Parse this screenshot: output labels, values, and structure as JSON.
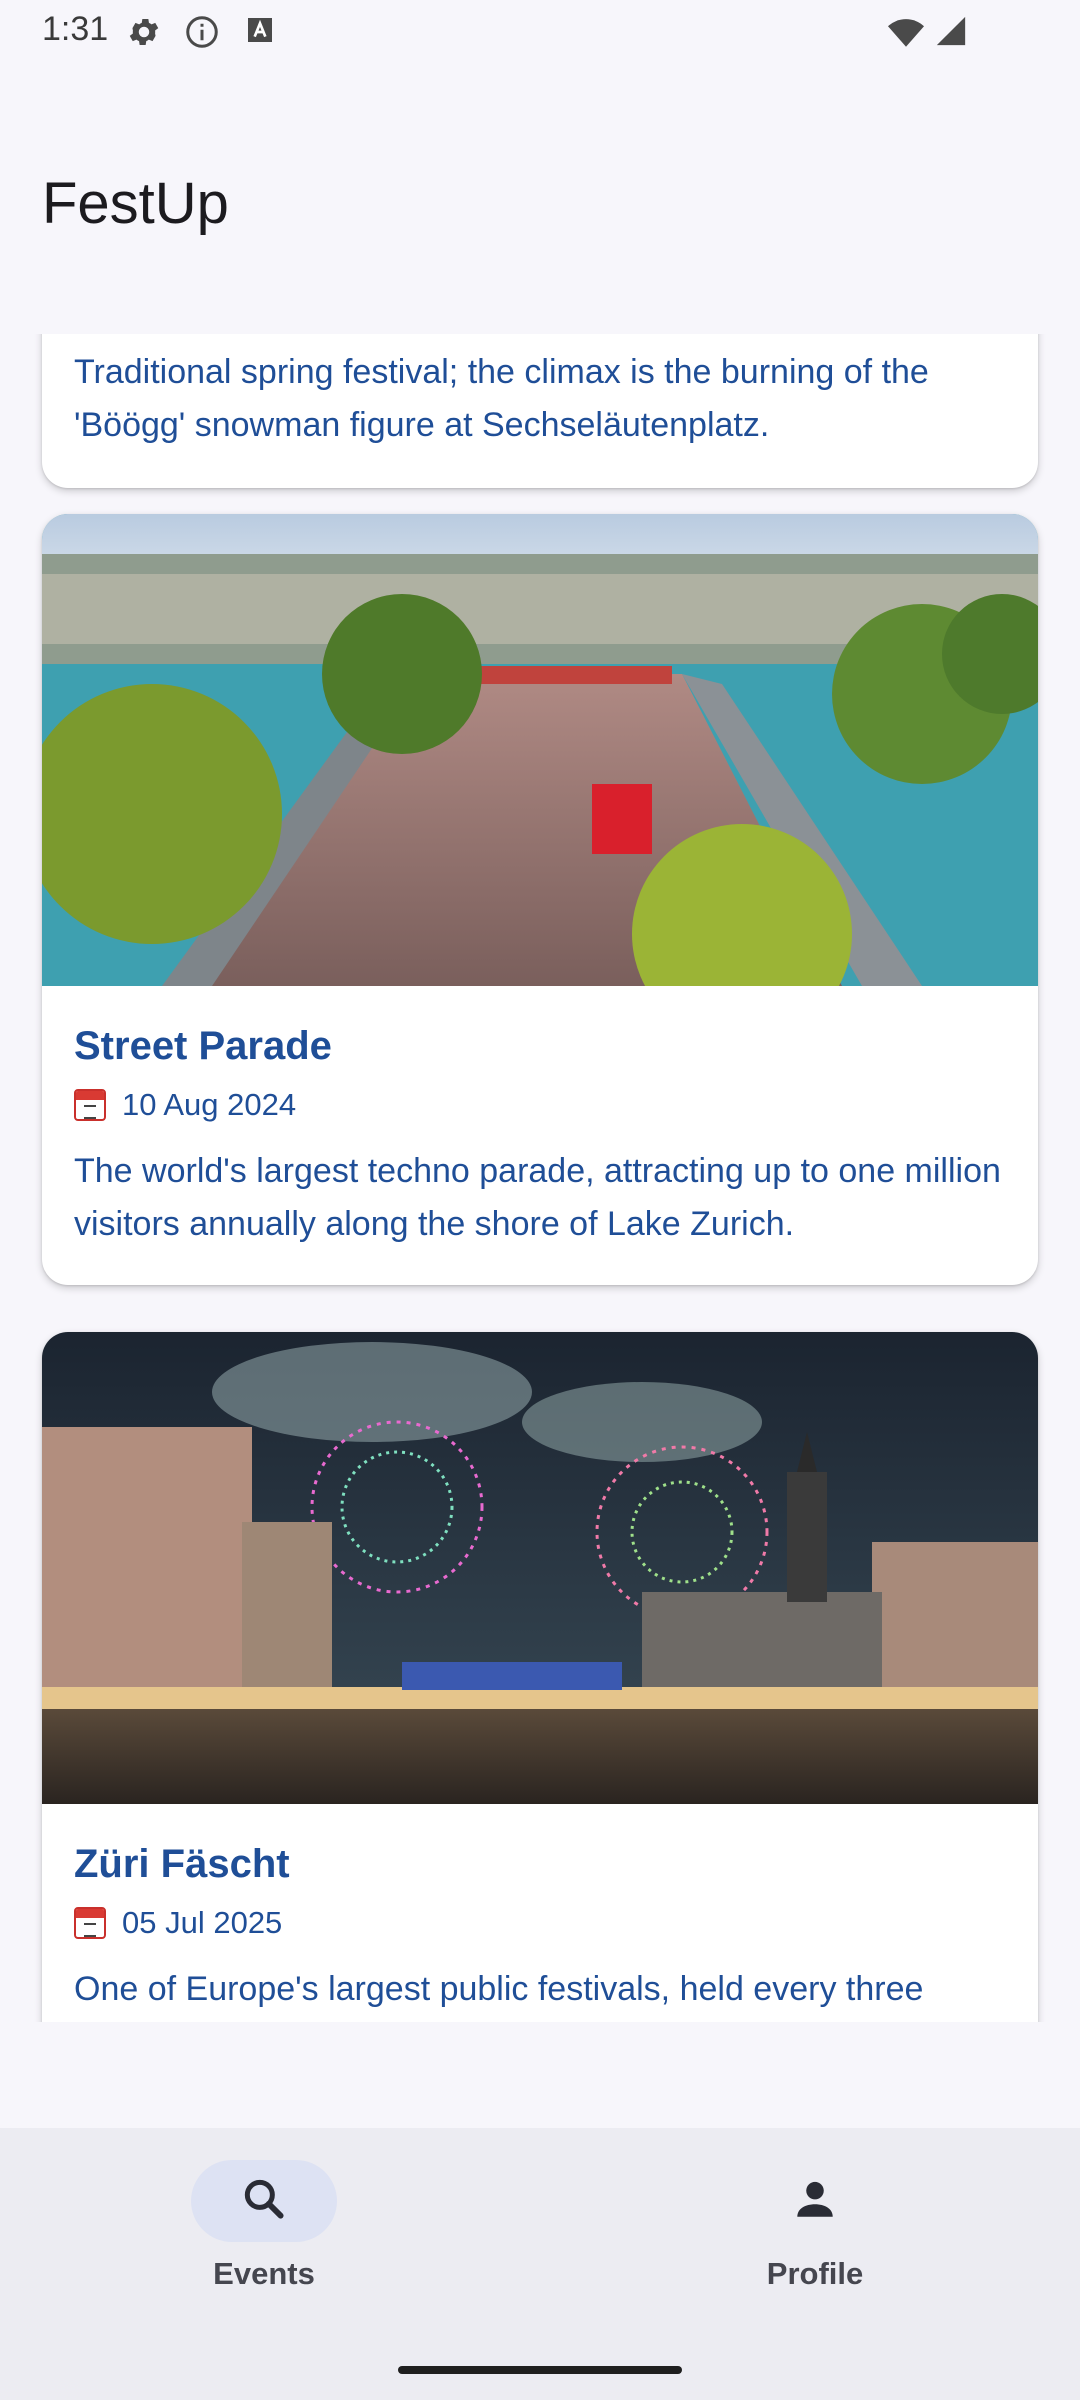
{
  "status_bar": {
    "time": "1:31",
    "icons": [
      "settings-icon",
      "info-icon",
      "text-a-icon",
      "wifi-icon",
      "signal-icon"
    ]
  },
  "app_bar": {
    "title": "FestUp"
  },
  "events": [
    {
      "title": "",
      "date": "",
      "description": "Traditional spring festival; the climax is the burning of the 'Böögg' snowman figure at Sechseläutenplatz."
    },
    {
      "title": "Street Parade",
      "date": "10 Aug 2024",
      "description": "The world's largest techno parade, attracting up to one million visitors annually along the shore of Lake Zurich."
    },
    {
      "title": "Züri Fäscht",
      "date": "05 Jul 2025",
      "description": "One of Europe's largest public festivals, held every three"
    }
  ],
  "bottom_nav": {
    "items": [
      {
        "label": "Events",
        "icon": "search-icon",
        "active": true
      },
      {
        "label": "Profile",
        "icon": "person-icon",
        "active": false
      }
    ]
  },
  "colors": {
    "accent_text": "#1f4e97",
    "nav_active_pill": "#dde2f3",
    "background": "#f7f6fb"
  }
}
